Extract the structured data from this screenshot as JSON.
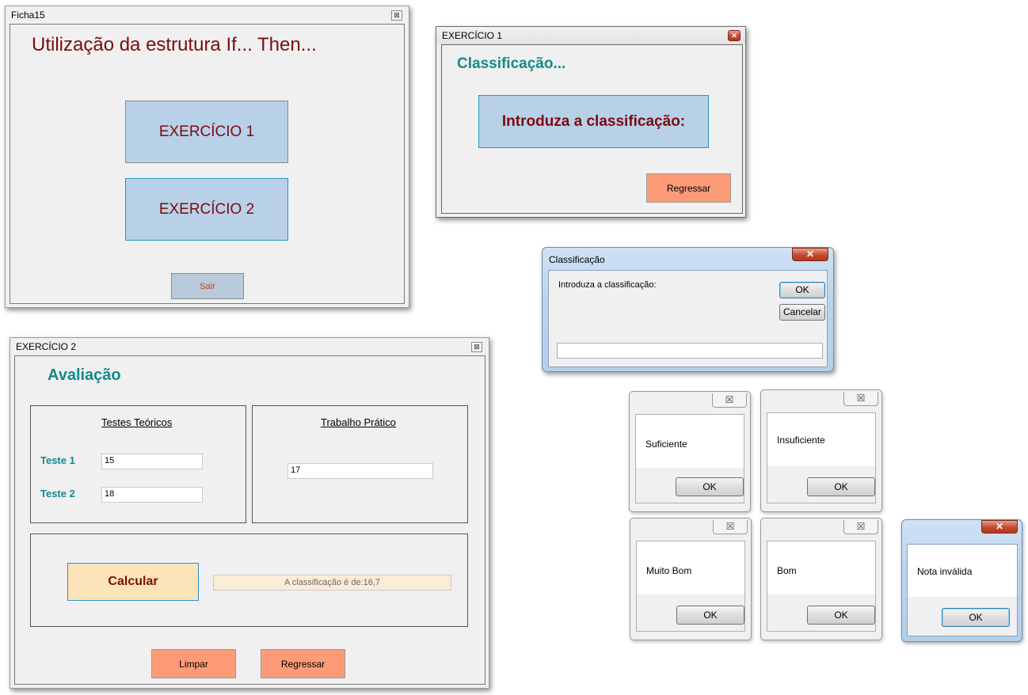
{
  "ficha15": {
    "title": "Ficha15",
    "close_glyph": "⊠",
    "heading": "Utilização da estrutura If... Then...",
    "btn_ex1": "EXERCÍCIO 1",
    "btn_ex2": "EXERCÍCIO 2",
    "btn_sair": "Sair"
  },
  "ex1": {
    "title": "EXERCÍCIO 1",
    "close_glyph": "✕",
    "heading": "Classificação...",
    "btn_intro": "Introduza a classificação:",
    "btn_regressar": "Regressar"
  },
  "inputbox": {
    "title": "Classificação",
    "close_glyph": "✕",
    "prompt": "Introduza a classificação:",
    "ok": "OK",
    "cancel": "Cancelar",
    "value": ""
  },
  "ex2": {
    "title": "EXERCÍCIO 2",
    "close_glyph": "⊠",
    "heading": "Avaliação",
    "group_teoricos": "Testes Teóricos",
    "teste1_label": "Teste 1",
    "teste1_value": "15",
    "teste2_label": "Teste 2",
    "teste2_value": "18",
    "group_pratico": "Trabalho Prático",
    "pratico_value": "17",
    "btn_calcular": "Calcular",
    "result": "A classificação é de:16,7",
    "btn_limpar": "Limpar",
    "btn_regressar": "Regressar"
  },
  "msgboxes": [
    {
      "message": "Suficiente",
      "ok": "OK",
      "close_glyph": "☒"
    },
    {
      "message": "Insuficiente",
      "ok": "OK",
      "close_glyph": "☒"
    },
    {
      "message": "Muito Bom",
      "ok": "OK",
      "close_glyph": "☒"
    },
    {
      "message": "Bom",
      "ok": "OK",
      "close_glyph": "☒"
    },
    {
      "message": "Nota inválida",
      "ok": "OK",
      "close_glyph": "✕"
    }
  ],
  "colors": {
    "dark_red": "#7b0d0d",
    "teal": "#138a8a",
    "button_blue": "#b9d0e9",
    "button_salmon": "#fd9b78",
    "button_peach": "#fde3b8"
  }
}
